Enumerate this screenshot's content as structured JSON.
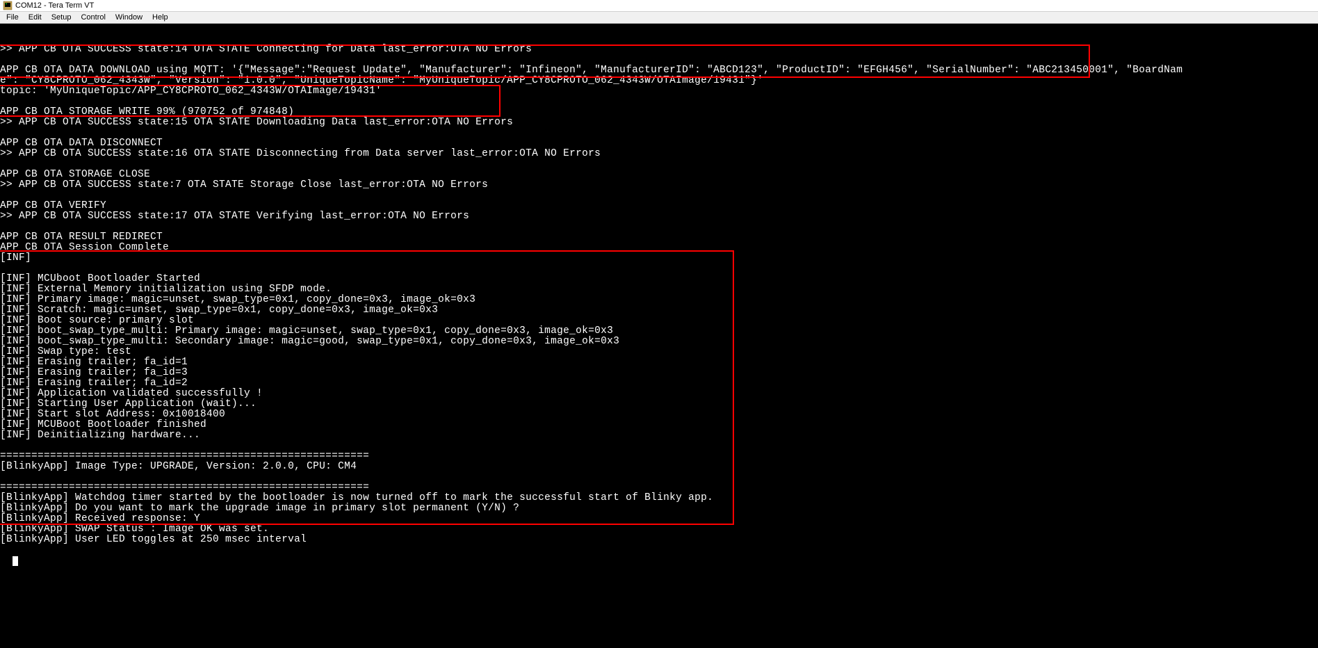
{
  "window": {
    "title": "COM12 - Tera Term VT"
  },
  "menu": {
    "file": "File",
    "edit": "Edit",
    "setup": "Setup",
    "control": "Control",
    "window": "Window",
    "help": "Help"
  },
  "terminal": {
    "lines": [
      ">> APP CB OTA SUCCESS state:14 OTA STATE Connecting for Data last_error:OTA NO Errors",
      "",
      "APP CB OTA DATA DOWNLOAD using MQTT: '{\"Message\":\"Request Update\", \"Manufacturer\": \"Infineon\", \"ManufacturerID\": \"ABCD123\", \"ProductID\": \"EFGH456\", \"SerialNumber\": \"ABC213450001\", \"BoardNam",
      "e\": \"CY8CPROTO_062_4343W\", \"Version\": \"1.0.0\", \"UniqueTopicName\": \"MyUniqueTopic/APP_CY8CPROTO_062_4343W/OTAImage/19431\"}'",
      "topic: 'MyUniqueTopic/APP_CY8CPROTO_062_4343W/OTAImage/19431'",
      "",
      "APP CB OTA STORAGE WRITE 99% (970752 of 974848)",
      ">> APP CB OTA SUCCESS state:15 OTA STATE Downloading Data last_error:OTA NO Errors",
      "",
      "APP CB OTA DATA DISCONNECT",
      ">> APP CB OTA SUCCESS state:16 OTA STATE Disconnecting from Data server last_error:OTA NO Errors",
      "",
      "APP CB OTA STORAGE CLOSE",
      ">> APP CB OTA SUCCESS state:7 OTA STATE Storage Close last_error:OTA NO Errors",
      "",
      "APP CB OTA VERIFY",
      ">> APP CB OTA SUCCESS state:17 OTA STATE Verifying last_error:OTA NO Errors",
      "",
      "APP CB OTA RESULT REDIRECT",
      "APP CB OTA Session Complete",
      "[INF]",
      "",
      "[INF] MCUboot Bootloader Started",
      "[INF] External Memory initialization using SFDP mode.",
      "[INF] Primary image: magic=unset, swap_type=0x1, copy_done=0x3, image_ok=0x3",
      "[INF] Scratch: magic=unset, swap_type=0x1, copy_done=0x3, image_ok=0x3",
      "[INF] Boot source: primary slot",
      "[INF] boot_swap_type_multi: Primary image: magic=unset, swap_type=0x1, copy_done=0x3, image_ok=0x3",
      "[INF] boot_swap_type_multi: Secondary image: magic=good, swap_type=0x1, copy_done=0x3, image_ok=0x3",
      "[INF] Swap type: test",
      "[INF] Erasing trailer; fa_id=1",
      "[INF] Erasing trailer; fa_id=3",
      "[INF] Erasing trailer; fa_id=2",
      "[INF] Application validated successfully !",
      "[INF] Starting User Application (wait)...",
      "[INF] Start slot Address: 0x10018400",
      "[INF] MCUBoot Bootloader finished",
      "[INF] Deinitializing hardware...",
      "",
      "===========================================================",
      "[BlinkyApp] Image Type: UPGRADE, Version: 2.0.0, CPU: CM4",
      "",
      "===========================================================",
      "[BlinkyApp] Watchdog timer started by the bootloader is now turned off to mark the successful start of Blinky app.",
      "[BlinkyApp] Do you want to mark the upgrade image in primary slot permanent (Y/N) ?",
      "[BlinkyApp] Received response: Y",
      "[BlinkyApp] SWAP Status : Image OK was set.",
      "[BlinkyApp] User LED toggles at 250 msec interval"
    ]
  }
}
